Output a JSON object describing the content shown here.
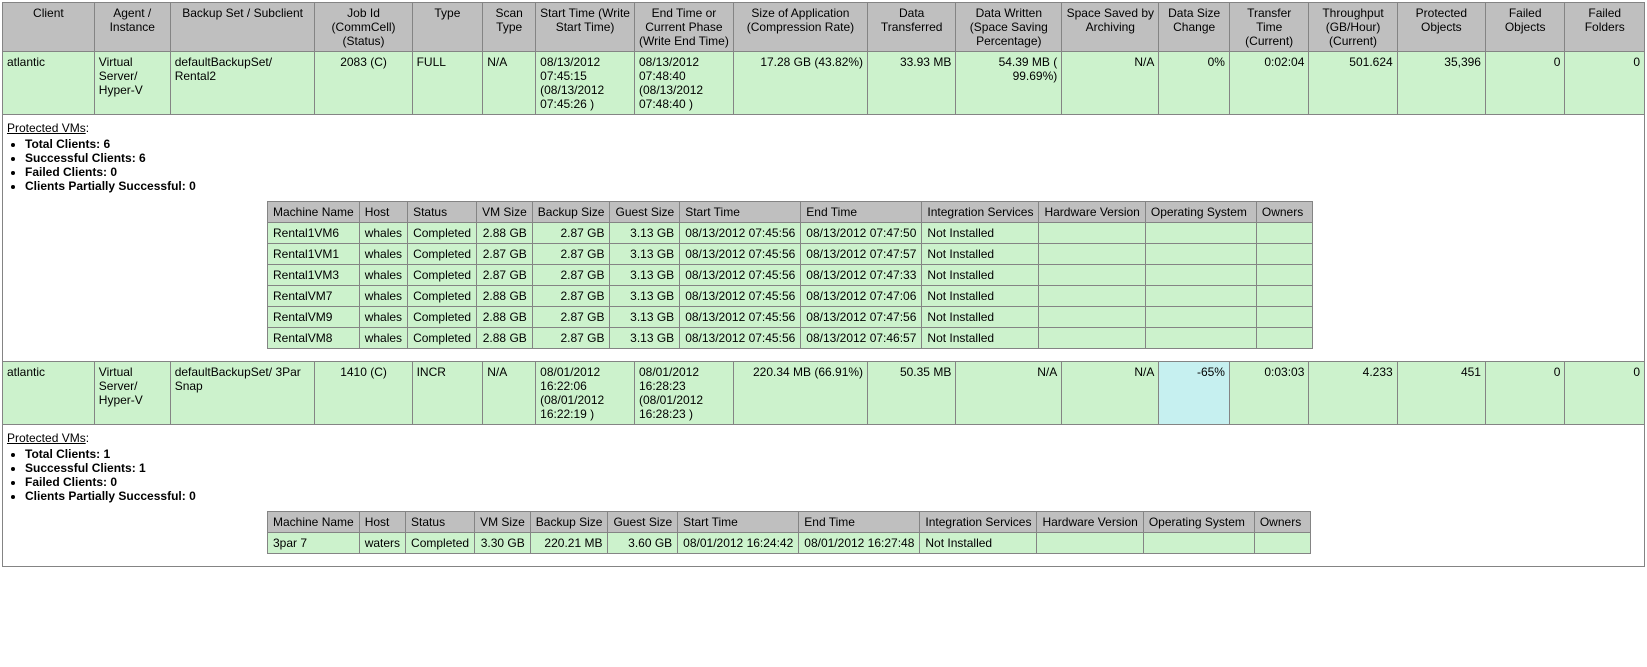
{
  "main_headers": [
    "Client",
    "Agent / Instance",
    "Backup Set / Subclient",
    "Job Id (CommCell) (Status)",
    "Type",
    "Scan Type",
    "Start Time (Write Start Time)",
    "End Time or Current Phase (Write End Time)",
    "Size of Application (Compression Rate)",
    "Data Transferred",
    "Data Written (Space Saving Percentage)",
    "Space Saved by Archiving",
    "Data Size Change",
    "Transfer Time (Current)",
    "Throughput (GB/Hour) (Current)",
    "Protected Objects",
    "Failed Objects",
    "Failed Folders"
  ],
  "jobs": [
    {
      "client": "atlantic",
      "agent": "Virtual Server/ Hyper-V",
      "backupset": "defaultBackupSet/ Rental2",
      "jobid": "2083 (C)",
      "type": "FULL",
      "scantype": "N/A",
      "start": "08/13/2012 07:45:15 (08/13/2012 07:45:26 )",
      "end": "08/13/2012 07:48:40 (08/13/2012 07:48:40 )",
      "size": "17.28 GB (43.82%)",
      "transferred": "33.93 MB",
      "written": "54.39 MB ( 99.69%)",
      "spacesaved": "N/A",
      "sizechange": "0%",
      "transfertime": "0:02:04",
      "throughput": "501.624",
      "protected": "35,396",
      "failedobj": "0",
      "failedfold": "0",
      "sizechange_hl": false,
      "summary": {
        "title": "Protected VMs",
        "lines": [
          "Total Clients: 6",
          "Successful Clients: 6",
          "Failed Clients: 0",
          "Clients Partially Successful: 0"
        ]
      },
      "vm_headers": [
        "Machine Name",
        "Host",
        "Status",
        "VM Size",
        "Backup Size",
        "Guest Size",
        "Start Time",
        "End Time",
        "Integration Services",
        "Hardware Version",
        "Operating System",
        "Owners"
      ],
      "vms": [
        {
          "name": "Rental1VM6",
          "host": "whales",
          "status": "Completed",
          "vmsize": "2.88 GB",
          "backupsize": "2.87 GB",
          "guestsize": "3.13 GB",
          "start": "08/13/2012 07:45:56",
          "end": "08/13/2012 07:47:50",
          "int": "Not Installed",
          "hw": "",
          "os": "",
          "own": ""
        },
        {
          "name": "Rental1VM1",
          "host": "whales",
          "status": "Completed",
          "vmsize": "2.87 GB",
          "backupsize": "2.87 GB",
          "guestsize": "3.13 GB",
          "start": "08/13/2012 07:45:56",
          "end": "08/13/2012 07:47:57",
          "int": "Not Installed",
          "hw": "",
          "os": "",
          "own": ""
        },
        {
          "name": "Rental1VM3",
          "host": "whales",
          "status": "Completed",
          "vmsize": "2.87 GB",
          "backupsize": "2.87 GB",
          "guestsize": "3.13 GB",
          "start": "08/13/2012 07:45:56",
          "end": "08/13/2012 07:47:33",
          "int": "Not Installed",
          "hw": "",
          "os": "",
          "own": ""
        },
        {
          "name": "RentalVM7",
          "host": "whales",
          "status": "Completed",
          "vmsize": "2.88 GB",
          "backupsize": "2.87 GB",
          "guestsize": "3.13 GB",
          "start": "08/13/2012 07:45:56",
          "end": "08/13/2012 07:47:06",
          "int": "Not Installed",
          "hw": "",
          "os": "",
          "own": ""
        },
        {
          "name": "RentalVM9",
          "host": "whales",
          "status": "Completed",
          "vmsize": "2.88 GB",
          "backupsize": "2.87 GB",
          "guestsize": "3.13 GB",
          "start": "08/13/2012 07:45:56",
          "end": "08/13/2012 07:47:56",
          "int": "Not Installed",
          "hw": "",
          "os": "",
          "own": ""
        },
        {
          "name": "RentalVM8",
          "host": "whales",
          "status": "Completed",
          "vmsize": "2.88 GB",
          "backupsize": "2.87 GB",
          "guestsize": "3.13 GB",
          "start": "08/13/2012 07:45:56",
          "end": "08/13/2012 07:46:57",
          "int": "Not Installed",
          "hw": "",
          "os": "",
          "own": ""
        }
      ]
    },
    {
      "client": "atlantic",
      "agent": "Virtual Server/ Hyper-V",
      "backupset": "defaultBackupSet/ 3Par Snap",
      "jobid": "1410 (C)",
      "type": "INCR",
      "scantype": "N/A",
      "start": "08/01/2012 16:22:06 (08/01/2012 16:22:19 )",
      "end": "08/01/2012 16:28:23 (08/01/2012 16:28:23 )",
      "size": "220.34 MB (66.91%)",
      "transferred": "50.35 MB",
      "written": "N/A",
      "spacesaved": "N/A",
      "sizechange": "-65%",
      "transfertime": "0:03:03",
      "throughput": "4.233",
      "protected": "451",
      "failedobj": "0",
      "failedfold": "0",
      "sizechange_hl": true,
      "summary": {
        "title": "Protected VMs",
        "lines": [
          "Total Clients: 1",
          "Successful Clients: 1",
          "Failed Clients: 0",
          "Clients Partially Successful: 0"
        ]
      },
      "vm_headers": [
        "Machine Name",
        "Host",
        "Status",
        "VM Size",
        "Backup Size",
        "Guest Size",
        "Start Time",
        "End Time",
        "Integration Services",
        "Hardware Version",
        "Operating System",
        "Owners"
      ],
      "vms": [
        {
          "name": "3par 7",
          "host": "waters",
          "status": "Completed",
          "vmsize": "3.30 GB",
          "backupsize": "220.21 MB",
          "guestsize": "3.60 GB",
          "start": "08/01/2012 16:24:42",
          "end": "08/01/2012 16:27:48",
          "int": "Not Installed",
          "hw": "",
          "os": "",
          "own": ""
        }
      ]
    }
  ],
  "col_widths": [
    "5.2%",
    "4.3%",
    "8.2%",
    "5.5%",
    "4.0%",
    "3.0%",
    "5.6%",
    "5.6%",
    "7.6%",
    "5.0%",
    "6.0%",
    "5.5%",
    "4.0%",
    "4.5%",
    "5.0%",
    "5.0%",
    "4.5%",
    "4.5%"
  ]
}
